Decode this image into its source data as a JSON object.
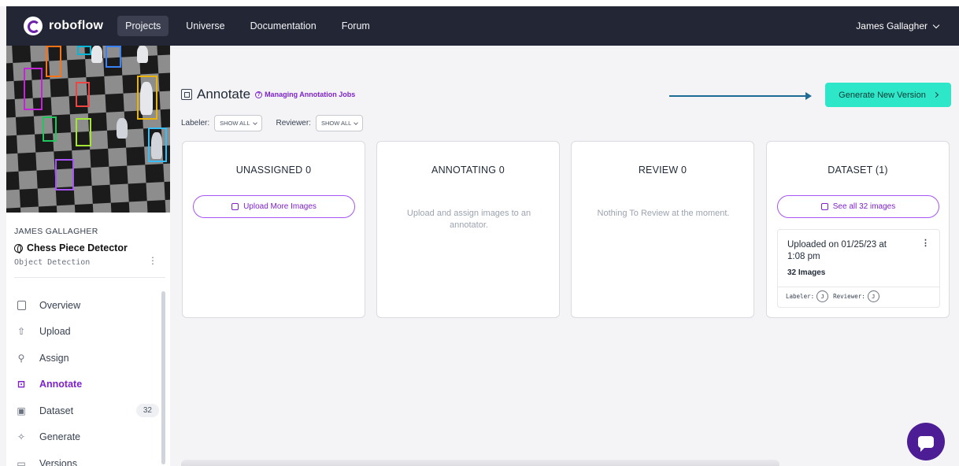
{
  "navbar": {
    "logo_text": "roboflow",
    "items": [
      {
        "label": "Projects",
        "active": true
      },
      {
        "label": "Universe",
        "active": false
      },
      {
        "label": "Documentation",
        "active": false
      },
      {
        "label": "Forum",
        "active": false
      }
    ],
    "user_name": "James Gallagher"
  },
  "sidebar": {
    "owner": "JAMES GALLAGHER",
    "project_name": "Chess Piece Detector",
    "project_type": "Object Detection",
    "items": [
      {
        "label": "Overview",
        "icon": "document-icon"
      },
      {
        "label": "Upload",
        "icon": "upload-icon"
      },
      {
        "label": "Assign",
        "icon": "search-icon"
      },
      {
        "label": "Annotate",
        "icon": "annotate-icon",
        "active": true
      },
      {
        "label": "Dataset",
        "icon": "images-icon",
        "badge": "32"
      },
      {
        "label": "Generate",
        "icon": "generate-icon"
      },
      {
        "label": "Versions",
        "icon": "folder-icon"
      }
    ]
  },
  "main": {
    "title": "Annotate",
    "help_link": "Managing Annotation Jobs",
    "labeler_label": "Labeler:",
    "labeler_value": "SHOW ALL",
    "reviewer_label": "Reviewer:",
    "reviewer_value": "SHOW ALL",
    "generate_button": "Generate New Version",
    "accent_color": "#2ee6c8",
    "brand_color": "#7e22ce"
  },
  "columns": {
    "unassigned": {
      "title": "UNASSIGNED 0",
      "button": "Upload More Images"
    },
    "annotating": {
      "title": "ANNOTATING 0",
      "message": "Upload and assign images to an annotator."
    },
    "review": {
      "title": "REVIEW 0",
      "message": "Nothing To Review at the moment."
    },
    "dataset": {
      "title": "DATASET (1)",
      "button": "See all 32 images",
      "card": {
        "uploaded": "Uploaded on 01/25/23 at 1:08 pm",
        "count": "32 Images",
        "labeler_label": "Labeler:",
        "labeler_initial": "J",
        "reviewer_label": "Reviewer:",
        "reviewer_initial": "J"
      }
    }
  }
}
